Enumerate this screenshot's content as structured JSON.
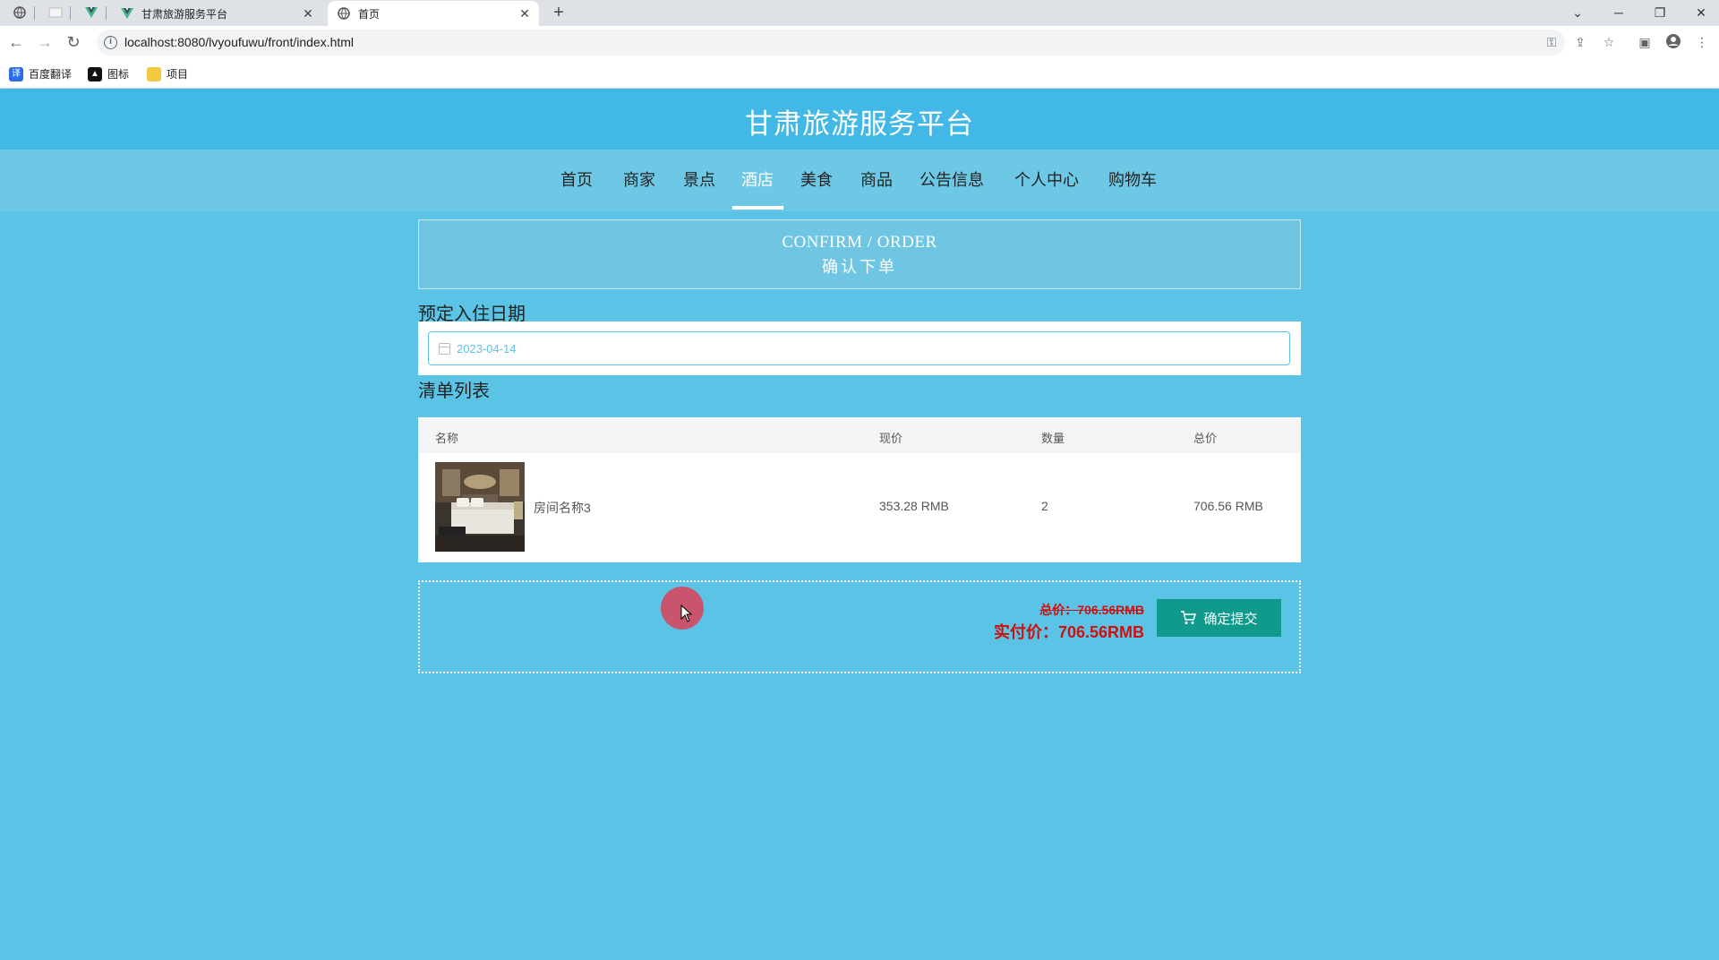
{
  "browser": {
    "tabs": [
      {
        "title": "甘肃旅游服务平台",
        "active": false
      },
      {
        "title": "首页",
        "active": true
      }
    ],
    "url": "localhost:8080/lvyoufuwu/front/index.html",
    "bookmarks": [
      "百度翻译",
      "图标",
      "项目"
    ]
  },
  "site": {
    "title": "甘肃旅游服务平台",
    "nav": [
      "首页",
      "商家",
      "景点",
      "酒店",
      "美食",
      "商品",
      "公告信息",
      "个人中心",
      "购物车"
    ],
    "active_nav": "酒店"
  },
  "confirm": {
    "title_en": "CONFIRM / ORDER",
    "title_cn": "确认下单"
  },
  "checkin": {
    "label": "预定入住日期",
    "date": "2023-04-14"
  },
  "cart": {
    "label": "清单列表",
    "headers": [
      "名称",
      "现价",
      "数量",
      "总价"
    ],
    "rows": [
      {
        "name": "房间名称3",
        "price": "353.28 RMB",
        "qty": "2",
        "total": "706.56 RMB"
      }
    ]
  },
  "summary": {
    "old_total": "总价：706.56RMB",
    "real_total": "实付价：706.56RMB",
    "submit_label": "确定提交"
  },
  "colors": {
    "page_bg": "#5bc4e6",
    "header_bg": "#42b8e6",
    "price_red": "#cc1111",
    "button_teal": "#0f9a8c"
  }
}
